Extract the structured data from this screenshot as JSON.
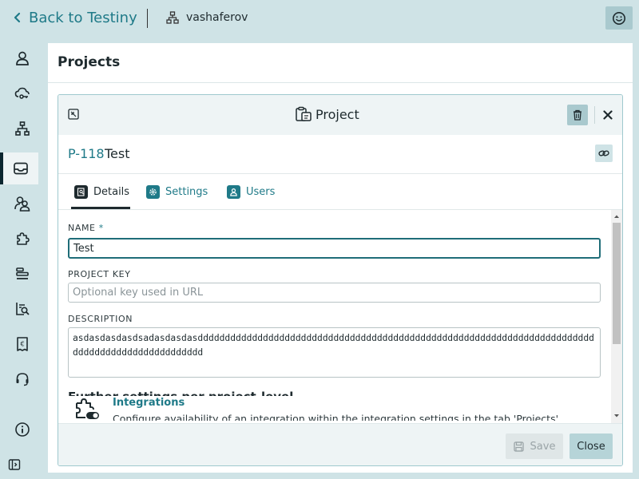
{
  "topbar": {
    "back_label": "Back to Testiny",
    "username": "vashaferov",
    "smiley_icon": "smiley-icon"
  },
  "sidebar": {
    "items": [
      {
        "icon": "user-icon"
      },
      {
        "icon": "cloud-key-icon"
      },
      {
        "icon": "hierarchy-icon"
      },
      {
        "icon": "inbox-icon",
        "active": true
      },
      {
        "icon": "user-group-icon"
      },
      {
        "icon": "puzzle-icon"
      },
      {
        "icon": "list-icon"
      },
      {
        "icon": "report-search-icon"
      },
      {
        "icon": "billing-icon"
      },
      {
        "icon": "headset-icon"
      },
      {
        "icon": "info-icon"
      },
      {
        "icon": "expand-sidebar-icon"
      }
    ]
  },
  "page": {
    "title": "Projects"
  },
  "panel": {
    "title": "Project",
    "project_key": "P-118",
    "project_name": "Test",
    "tabs": {
      "details": "Details",
      "settings": "Settings",
      "users": "Users"
    },
    "fields": {
      "name_label": "NAME",
      "name_required": "*",
      "name_value": "Test",
      "key_label": "PROJECT KEY",
      "key_placeholder": "Optional key used in URL",
      "description_label": "DESCRIPTION",
      "description_value": "asdasdasdasdsadasdasdasddddddddddddddddddddddddddddddddddddddddddddddddddddddddddddddddddddddddddddddddddddddddddddddddd"
    },
    "clipped_heading": "Further settings per project-level",
    "integrations": {
      "title": "Integrations",
      "description": "Configure availability of an integration within the integration settings in the tab 'Projects'"
    },
    "footer": {
      "save_label": "Save",
      "close_label": "Close"
    }
  },
  "colors": {
    "accent": "#1f7a88",
    "background": "#cfe3e6",
    "panel_header": "#eef4f5",
    "button_bg": "#b6d4d8"
  }
}
